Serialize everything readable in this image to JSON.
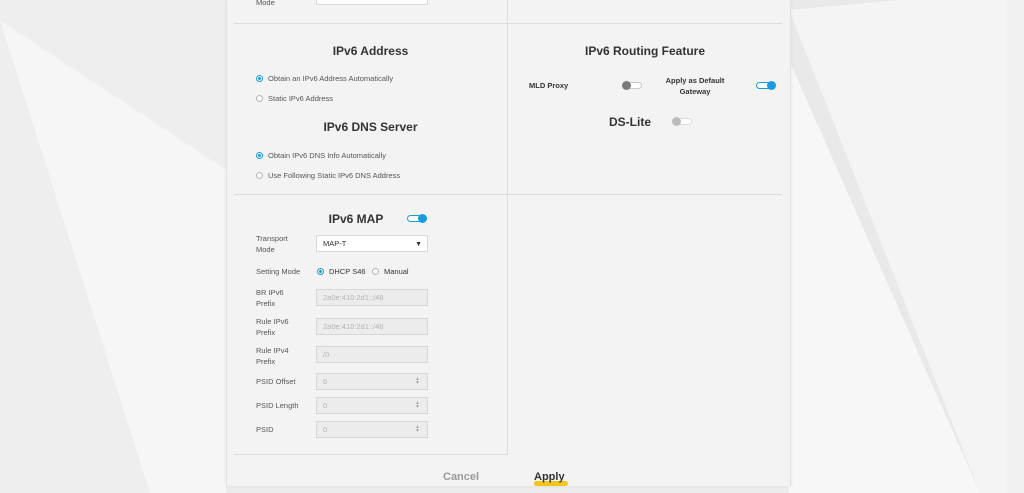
{
  "top": {
    "mode_label": "Mode"
  },
  "ipv6_address": {
    "title": "IPv6 Address",
    "options": [
      "Obtain an IPv6 Address Automatically",
      "Static IPv6 Address"
    ],
    "selected": "Obtain an IPv6 Address Automatically"
  },
  "ipv6_dns": {
    "title": "IPv6 DNS Server",
    "options": [
      "Obtain IPv6 DNS Info Automatically",
      "Use Following Static IPv6 DNS Address"
    ],
    "selected": "Obtain IPv6 DNS Info Automatically"
  },
  "routing": {
    "title": "IPv6 Routing Feature",
    "mld_proxy_label": "MLD Proxy",
    "mld_proxy_on": false,
    "default_gateway_label": "Apply as Default Gateway",
    "default_gateway_on": true,
    "ds_lite_label": "DS-Lite",
    "ds_lite_on": false
  },
  "ipv6_map": {
    "title": "IPv6 MAP",
    "enabled": true,
    "transport_mode_label": "Transport Mode",
    "transport_mode_value": "MAP-T",
    "setting_mode_label": "Setting Mode",
    "setting_mode_options": [
      "DHCP S46",
      "Manual"
    ],
    "setting_mode_selected": "DHCP S46",
    "br_ipv6_prefix_label": "BR IPv6 Prefix",
    "br_ipv6_prefix_value": "2a0e:410:2d1::/48",
    "rule_ipv6_prefix_label": "Rule IPv6 Prefix",
    "rule_ipv6_prefix_value": "2a0e:410:2d1::/48",
    "rule_ipv4_prefix_label": "Rule IPv4 Prefix",
    "rule_ipv4_prefix_value": "/0",
    "psid_offset_label": "PSID Offset",
    "psid_offset_value": "6",
    "psid_length_label": "PSID Length",
    "psid_length_value": "0",
    "psid_label": "PSID",
    "psid_value": "0"
  },
  "actions": {
    "cancel_label": "Cancel",
    "apply_label": "Apply"
  },
  "colors": {
    "accent": "#1a9be0",
    "highlight": "#f5c518"
  }
}
